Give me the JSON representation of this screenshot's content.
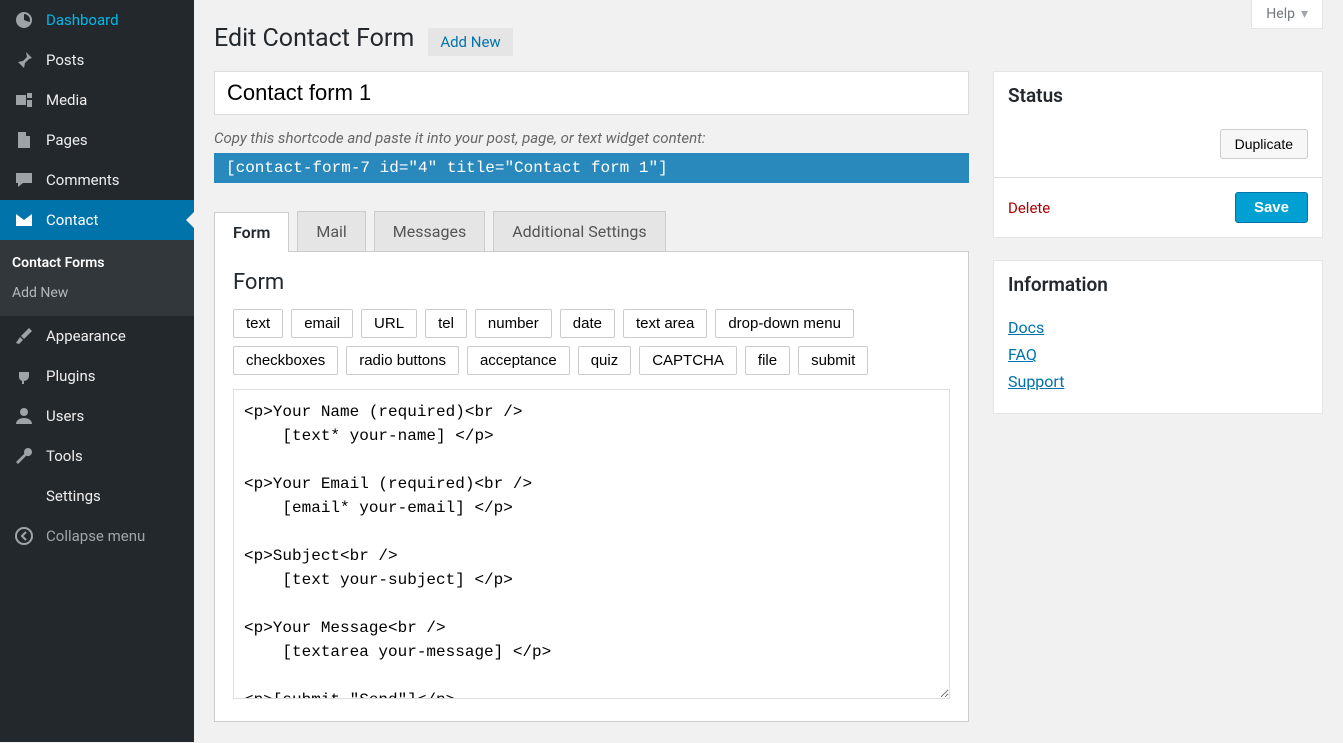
{
  "help_label": "Help",
  "sidebar": {
    "items": [
      {
        "label": "Dashboard"
      },
      {
        "label": "Posts"
      },
      {
        "label": "Media"
      },
      {
        "label": "Pages"
      },
      {
        "label": "Comments"
      },
      {
        "label": "Contact"
      },
      {
        "label": "Appearance"
      },
      {
        "label": "Plugins"
      },
      {
        "label": "Users"
      },
      {
        "label": "Tools"
      },
      {
        "label": "Settings"
      }
    ],
    "submenu": {
      "items": [
        {
          "label": "Contact Forms"
        },
        {
          "label": "Add New"
        }
      ]
    },
    "collapse_label": "Collapse menu"
  },
  "page": {
    "title": "Edit Contact Form",
    "add_new_label": "Add New",
    "form_title_value": "Contact form 1",
    "shortcode_hint": "Copy this shortcode and paste it into your post, page, or text widget content:",
    "shortcode": "[contact-form-7 id=\"4\" title=\"Contact form 1\"]"
  },
  "tabs": {
    "form": "Form",
    "mail": "Mail",
    "messages": "Messages",
    "additional": "Additional Settings"
  },
  "form_panel": {
    "heading": "Form",
    "tags": [
      "text",
      "email",
      "URL",
      "tel",
      "number",
      "date",
      "text area",
      "drop-down menu",
      "checkboxes",
      "radio buttons",
      "acceptance",
      "quiz",
      "CAPTCHA",
      "file",
      "submit"
    ],
    "template": "<p>Your Name (required)<br />\n    [text* your-name] </p>\n\n<p>Your Email (required)<br />\n    [email* your-email] </p>\n\n<p>Subject<br />\n    [text your-subject] </p>\n\n<p>Your Message<br />\n    [textarea your-message] </p>\n\n<p>[submit \"Send\"]</p>"
  },
  "status_box": {
    "title": "Status",
    "duplicate": "Duplicate",
    "delete": "Delete",
    "save": "Save"
  },
  "info_box": {
    "title": "Information",
    "links": [
      "Docs",
      "FAQ",
      "Support"
    ]
  }
}
